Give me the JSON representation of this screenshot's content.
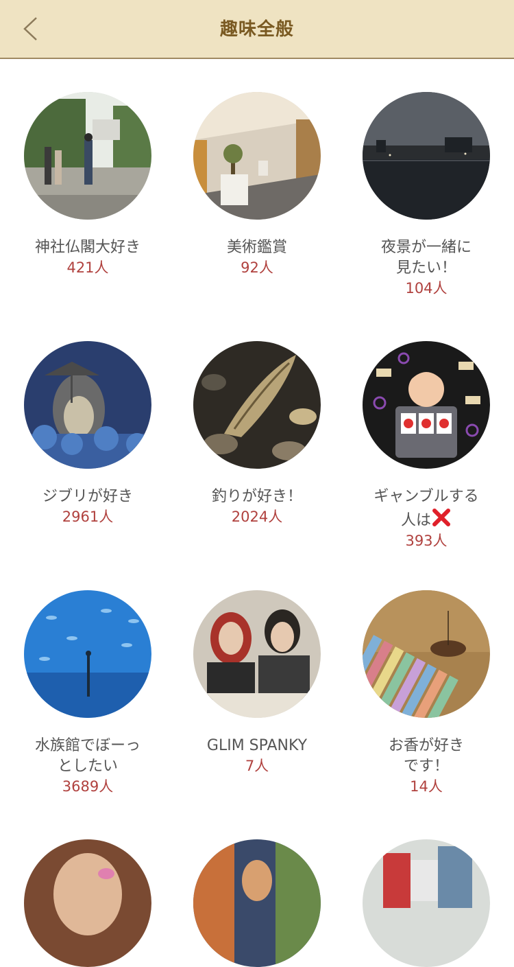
{
  "header": {
    "title": "趣味全般"
  },
  "hobbies": [
    {
      "name": "神社仏閣大好き",
      "count": "421人"
    },
    {
      "name": "美術鑑賞",
      "count": "92人"
    },
    {
      "name": "夜景が一緒に\n見たい！",
      "count": "104人"
    },
    {
      "name": "ジブリが好き",
      "count": "2961人"
    },
    {
      "name": "釣りが好き！",
      "count": "2024人"
    },
    {
      "name": "ギャンブルする\n人は",
      "count": "393人"
    },
    {
      "name": "水族館でぼーっ\nとしたい",
      "count": "3689人"
    },
    {
      "name": "GLIM SPANKY",
      "count": "7人"
    },
    {
      "name": "お香が好き\nです！",
      "count": "14人"
    }
  ],
  "colors": {
    "header_bg": "#efe3c2",
    "title": "#7a5a22",
    "count": "#b0413e",
    "name": "#555555"
  }
}
